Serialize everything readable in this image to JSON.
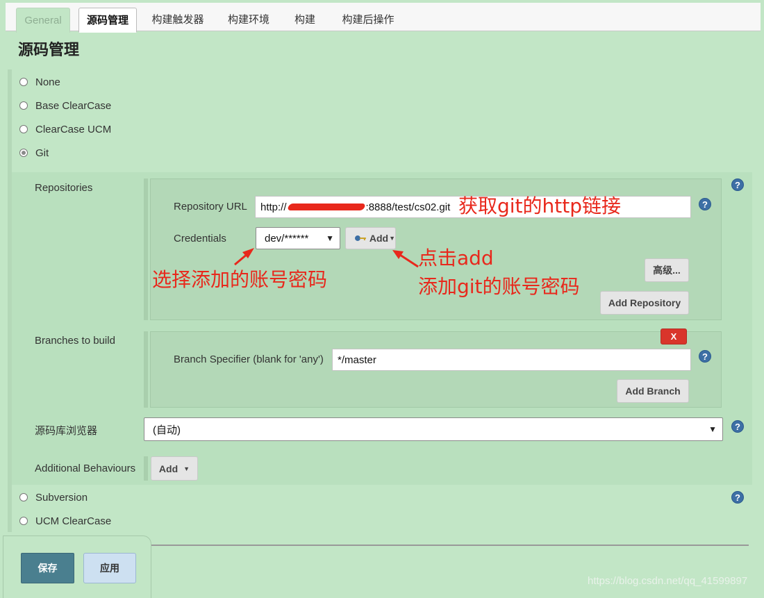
{
  "tabs": [
    "General",
    "源码管理",
    "构建触发器",
    "构建环境",
    "构建",
    "构建后操作"
  ],
  "section_title": "源码管理",
  "scm_options_top": [
    {
      "label": "None",
      "checked": false
    },
    {
      "label": "Base ClearCase",
      "checked": false
    },
    {
      "label": "ClearCase UCM",
      "checked": false
    },
    {
      "label": "Git",
      "checked": true
    }
  ],
  "scm_options_bottom": [
    {
      "label": "Subversion",
      "checked": false
    },
    {
      "label": "UCM ClearCase",
      "checked": false
    }
  ],
  "git": {
    "repositories_label": "Repositories",
    "repo_url_label": "Repository URL",
    "repo_url_prefix": "http://",
    "repo_url_suffix": ":8888/test/cs02.git",
    "credentials_label": "Credentials",
    "credentials_value": "dev/******",
    "add_credentials_label": "Add",
    "advanced_label": "高级...",
    "add_repository_label": "Add Repository",
    "branches_label": "Branches to build",
    "delete_label": "X",
    "branch_specifier_label": "Branch Specifier (blank for 'any')",
    "branch_specifier_value": "*/master",
    "add_branch_label": "Add Branch",
    "browser_label": "源码库浏览器",
    "browser_value": "(自动)",
    "additional_label": "Additional Behaviours",
    "additional_add_label": "Add"
  },
  "help_icon_text": "?",
  "annotations": {
    "url": "获取git的http链接",
    "select_account": "选择添加的账号密码",
    "click_add_line1": "点击add",
    "click_add_line2": "添加git的账号密码"
  },
  "footer": {
    "save_label": "保存",
    "apply_label": "应用"
  },
  "watermark": "https://blog.csdn.net/qq_41599897",
  "colors": {
    "page_bg": "#c2e6c6",
    "annotation_red": "#e8281c",
    "help_blue": "#3d6fa5",
    "save_button": "#4a7f8f",
    "delete_button": "#d9352b"
  }
}
